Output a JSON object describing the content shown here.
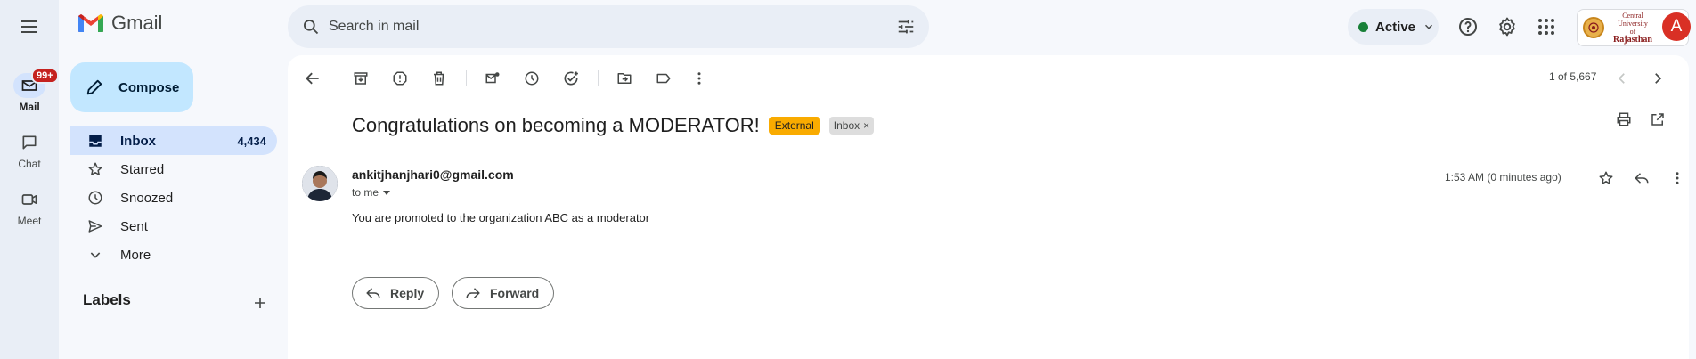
{
  "app": {
    "name": "Gmail"
  },
  "rail": {
    "items": [
      {
        "label": "Mail",
        "badge": "99+"
      },
      {
        "label": "Chat"
      },
      {
        "label": "Meet"
      }
    ]
  },
  "search": {
    "placeholder": "Search in mail"
  },
  "status": {
    "label": "Active",
    "color": "#188038"
  },
  "org": {
    "line1": "Central University",
    "line2": "of",
    "line3": "Rajasthan"
  },
  "account": {
    "initial": "A",
    "color": "#d93025"
  },
  "compose": {
    "label": "Compose"
  },
  "nav": {
    "items": [
      {
        "label": "Inbox",
        "count": "4,434",
        "icon": "inbox-icon"
      },
      {
        "label": "Starred",
        "count": "",
        "icon": "star-icon"
      },
      {
        "label": "Snoozed",
        "count": "",
        "icon": "clock-icon"
      },
      {
        "label": "Sent",
        "count": "",
        "icon": "send-icon"
      },
      {
        "label": "More",
        "count": "",
        "icon": "chevron-down-icon"
      }
    ]
  },
  "labels": {
    "heading": "Labels"
  },
  "toolbar": {
    "pager": "1 of 5,667"
  },
  "message": {
    "subject": "Congratulations on becoming a MODERATOR!",
    "tags": {
      "external": "External",
      "inbox": "Inbox",
      "inbox_remove": "×"
    },
    "sender": "ankitjhanjhari0@gmail.com",
    "recipient": "to me",
    "time": "1:53 AM (0 minutes ago)",
    "body": "You are promoted to the organization ABC as a moderator"
  },
  "actions": {
    "reply": "Reply",
    "forward": "Forward"
  },
  "colors": {
    "brand_red": "#ea4335",
    "accent_blue": "#d3e3fd",
    "compose_bg": "#c2e7ff",
    "external_tag": "#f9ab00"
  }
}
